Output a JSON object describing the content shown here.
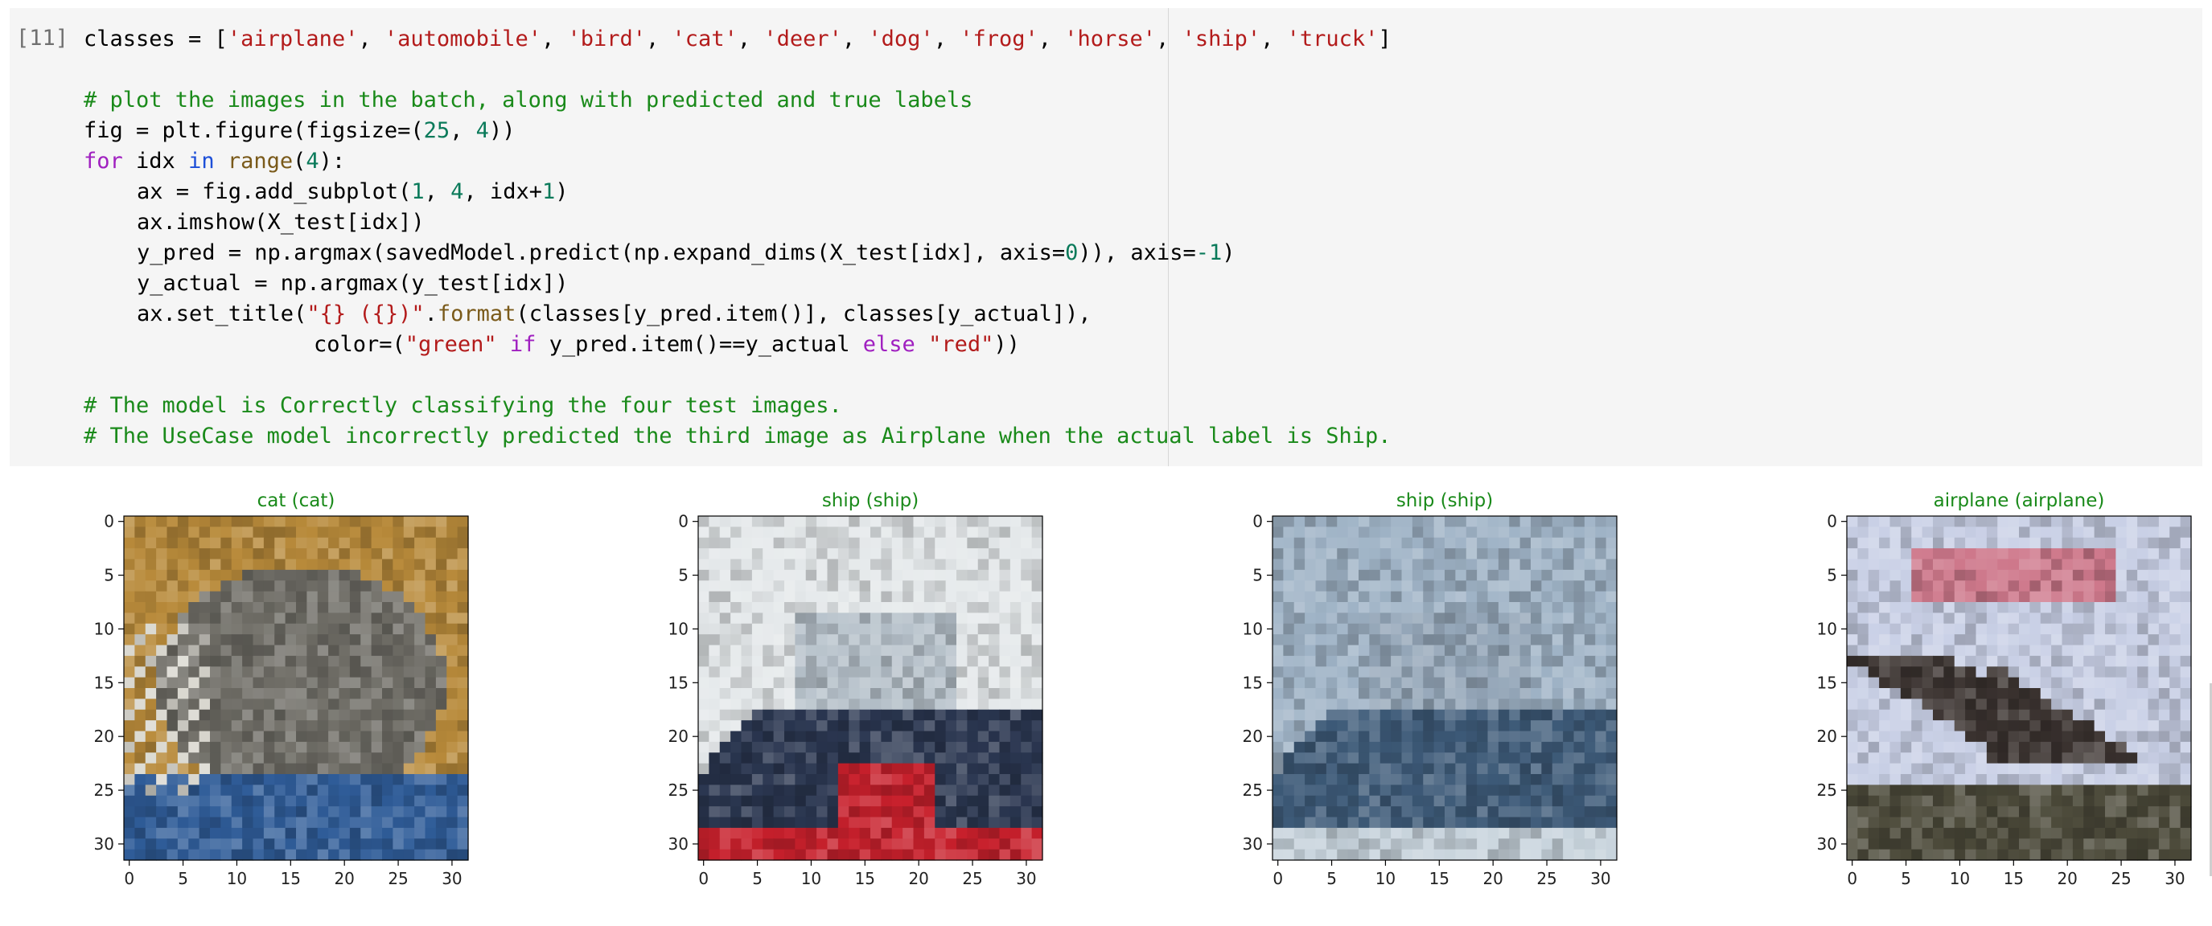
{
  "cell": {
    "prompt": "[11]",
    "code_lines": [
      {
        "indent": 1,
        "tokens": [
          {
            "t": "classes = [",
            "c": ""
          },
          {
            "t": "'airplane'",
            "c": "s"
          },
          {
            "t": ", ",
            "c": ""
          },
          {
            "t": "'automobile'",
            "c": "s"
          },
          {
            "t": ", ",
            "c": ""
          },
          {
            "t": "'bird'",
            "c": "s"
          },
          {
            "t": ", ",
            "c": ""
          },
          {
            "t": "'cat'",
            "c": "s"
          },
          {
            "t": ", ",
            "c": ""
          },
          {
            "t": "'deer'",
            "c": "s"
          },
          {
            "t": ", ",
            "c": ""
          },
          {
            "t": "'dog'",
            "c": "s"
          },
          {
            "t": ", ",
            "c": ""
          },
          {
            "t": "'frog'",
            "c": "s"
          },
          {
            "t": ", ",
            "c": ""
          },
          {
            "t": "'horse'",
            "c": "s"
          },
          {
            "t": ", ",
            "c": ""
          },
          {
            "t": "'ship'",
            "c": "s"
          },
          {
            "t": ", ",
            "c": ""
          },
          {
            "t": "'truck'",
            "c": "s"
          },
          {
            "t": "]",
            "c": ""
          }
        ]
      },
      {
        "indent": 1,
        "tokens": []
      },
      {
        "indent": 1,
        "tokens": [
          {
            "t": "# plot the images in the batch, along with predicted and true labels",
            "c": "c"
          }
        ]
      },
      {
        "indent": 1,
        "tokens": [
          {
            "t": "fig = plt.figure(figsize=(",
            "c": ""
          },
          {
            "t": "25",
            "c": "n"
          },
          {
            "t": ", ",
            "c": ""
          },
          {
            "t": "4",
            "c": "n"
          },
          {
            "t": "))",
            "c": ""
          }
        ]
      },
      {
        "indent": 1,
        "tokens": [
          {
            "t": "for",
            "c": "k"
          },
          {
            "t": " idx ",
            "c": ""
          },
          {
            "t": "in",
            "c": "kb"
          },
          {
            "t": " ",
            "c": ""
          },
          {
            "t": "range",
            "c": "f"
          },
          {
            "t": "(",
            "c": ""
          },
          {
            "t": "4",
            "c": "n"
          },
          {
            "t": "):",
            "c": ""
          }
        ]
      },
      {
        "indent": 2,
        "tokens": [
          {
            "t": "ax = fig.add_subplot(",
            "c": ""
          },
          {
            "t": "1",
            "c": "n"
          },
          {
            "t": ", ",
            "c": ""
          },
          {
            "t": "4",
            "c": "n"
          },
          {
            "t": ", idx+",
            "c": ""
          },
          {
            "t": "1",
            "c": "n"
          },
          {
            "t": ")",
            "c": ""
          }
        ]
      },
      {
        "indent": 2,
        "tokens": [
          {
            "t": "ax.imshow(X_test[idx])",
            "c": ""
          }
        ]
      },
      {
        "indent": 2,
        "tokens": [
          {
            "t": "y_pred = np.argmax(savedModel.predict(np.expand_dims(X_test[idx], axis=",
            "c": ""
          },
          {
            "t": "0",
            "c": "n"
          },
          {
            "t": ")), axis=",
            "c": ""
          },
          {
            "t": "-1",
            "c": "n"
          },
          {
            "t": ")",
            "c": ""
          }
        ]
      },
      {
        "indent": 2,
        "tokens": [
          {
            "t": "y_actual = np.argmax(y_test[idx])",
            "c": ""
          }
        ]
      },
      {
        "indent": 2,
        "tokens": [
          {
            "t": "ax.set_title(",
            "c": ""
          },
          {
            "t": "\"{} ({})\"",
            "c": "s"
          },
          {
            "t": ".",
            "c": ""
          },
          {
            "t": "format",
            "c": "f"
          },
          {
            "t": "(classes[y_pred.item()], classes[y_actual]),",
            "c": ""
          }
        ]
      },
      {
        "indent": 3,
        "tokens": [
          {
            "t": "color=(",
            "c": ""
          },
          {
            "t": "\"green\"",
            "c": "s"
          },
          {
            "t": " ",
            "c": ""
          },
          {
            "t": "if",
            "c": "k"
          },
          {
            "t": " y_pred.item()==y_actual ",
            "c": ""
          },
          {
            "t": "else",
            "c": "k"
          },
          {
            "t": " ",
            "c": ""
          },
          {
            "t": "\"red\"",
            "c": "s"
          },
          {
            "t": "))",
            "c": ""
          }
        ]
      },
      {
        "indent": 1,
        "tokens": []
      },
      {
        "indent": 1,
        "tokens": [
          {
            "t": "# The model is Correctly classifying the four test images.",
            "c": "c"
          }
        ]
      },
      {
        "indent": 1,
        "tokens": [
          {
            "t": "# The UseCase model incorrectly predicted the third image as Airplane when the actual label is Ship.",
            "c": "c"
          }
        ]
      }
    ]
  },
  "output": {
    "title_color": "#1a8a1a",
    "tick_labels": [
      "0",
      "5",
      "10",
      "15",
      "20",
      "25",
      "30"
    ],
    "subplots": [
      {
        "title": "cat (cat)",
        "image": "cat",
        "colors": {
          "bg": "#b88a3a",
          "main": "#6f6d66",
          "low": "#2f5c98"
        }
      },
      {
        "title": "ship (ship)",
        "image": "ship",
        "colors": {
          "bg": "#e4e8ea",
          "main": "#2a3650",
          "low": "#c8202c"
        }
      },
      {
        "title": "ship (ship)",
        "image": "ship",
        "colors": {
          "bg": "#9fb3c6",
          "main": "#3d5a78",
          "low": "#c7d3dc"
        }
      },
      {
        "title": "airplane (airplane)",
        "image": "airplane",
        "colors": {
          "bg": "#c9d0e6",
          "main": "#3b3330",
          "low": "#4c4a3a"
        }
      }
    ]
  }
}
